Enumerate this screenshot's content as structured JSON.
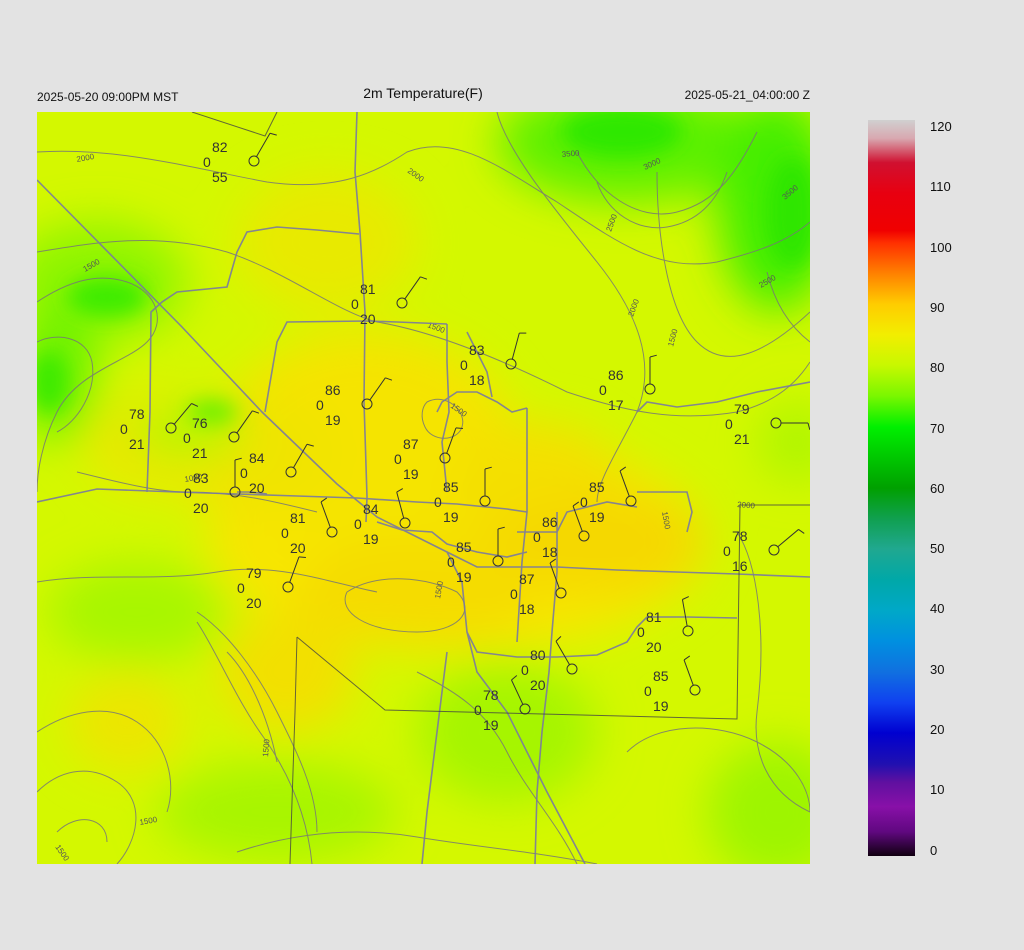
{
  "header": {
    "local_time": "2025-05-20 09:00PM MST",
    "title": "2m Temperature(F)",
    "valid_time": "2025-05-21_04:00:00 Z"
  },
  "colorbar": {
    "labels": [
      "120",
      "110",
      "100",
      "90",
      "80",
      "70",
      "60",
      "50",
      "40",
      "30",
      "20",
      "10",
      "0"
    ],
    "min": 0,
    "max": 120
  },
  "contour_labels": [
    "2000",
    "2000",
    "3500",
    "3000",
    "3500",
    "2500",
    "2500",
    "2000",
    "1500",
    "1500",
    "1500",
    "1500",
    "1000",
    "2000",
    "1500",
    "1500",
    "1500",
    "1500",
    "1500"
  ],
  "stations": [
    {
      "t": "82",
      "d": "55",
      "p": "0"
    },
    {
      "t": "81",
      "d": "20",
      "p": "0"
    },
    {
      "t": "83",
      "d": "18",
      "p": "0"
    },
    {
      "t": "86",
      "d": "17",
      "p": "0"
    },
    {
      "t": "86",
      "d": "19",
      "p": "0"
    },
    {
      "t": "78",
      "d": "21",
      "p": "0"
    },
    {
      "t": "76",
      "d": "21",
      "p": "0"
    },
    {
      "t": "79",
      "d": "21",
      "p": "0"
    },
    {
      "t": "87",
      "d": "19",
      "p": "0"
    },
    {
      "t": "84",
      "d": "20",
      "p": "0"
    },
    {
      "t": "83",
      "d": "20",
      "p": "0"
    },
    {
      "t": "85",
      "d": "19",
      "p": "0"
    },
    {
      "t": "85",
      "d": "19",
      "p": "0"
    },
    {
      "t": "84",
      "d": "19",
      "p": "0"
    },
    {
      "t": "81",
      "d": "20",
      "p": "0"
    },
    {
      "t": "86",
      "d": "18",
      "p": "0"
    },
    {
      "t": "85",
      "d": "19",
      "p": "0"
    },
    {
      "t": "78",
      "d": "16",
      "p": "0"
    },
    {
      "t": "79",
      "d": "20",
      "p": "0"
    },
    {
      "t": "87",
      "d": "18",
      "p": "0"
    },
    {
      "t": "81",
      "d": "20",
      "p": "0"
    },
    {
      "t": "80",
      "d": "20",
      "p": "0"
    },
    {
      "t": "85",
      "d": "19",
      "p": "0"
    },
    {
      "t": "78",
      "d": "19",
      "p": "0"
    }
  ]
}
